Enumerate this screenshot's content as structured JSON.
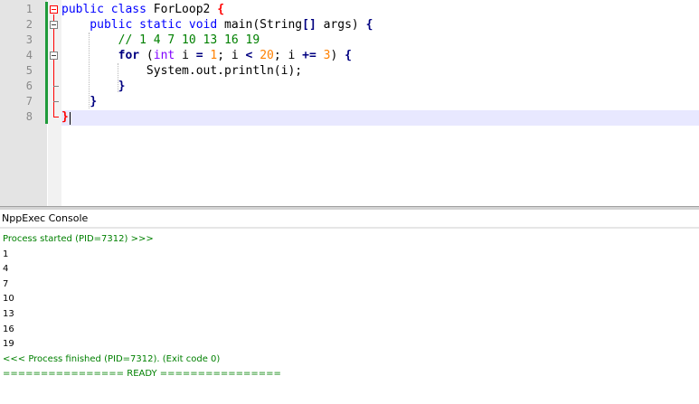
{
  "editor": {
    "line_numbers": [
      "1",
      "2",
      "3",
      "4",
      "5",
      "6",
      "7",
      "8"
    ],
    "lines": [
      [
        {
          "t": "public class ",
          "c": "kw"
        },
        {
          "t": "ForLoop2 ",
          "c": "plain"
        },
        {
          "t": "{",
          "c": "brace-red"
        }
      ],
      [
        {
          "t": "    public static void ",
          "c": "kw"
        },
        {
          "t": "main(",
          "c": "plain"
        },
        {
          "t": "String",
          "c": "plain"
        },
        {
          "t": "[]",
          "c": "op"
        },
        {
          "t": " args) ",
          "c": "plain"
        },
        {
          "t": "{",
          "c": "op"
        }
      ],
      [
        {
          "t": "        // 1 4 7 10 13 16 19",
          "c": "comment"
        }
      ],
      [
        {
          "t": "        ",
          "c": "plain"
        },
        {
          "t": "for",
          "c": "op"
        },
        {
          "t": " (",
          "c": "plain"
        },
        {
          "t": "int",
          "c": "type"
        },
        {
          "t": " i ",
          "c": "plain"
        },
        {
          "t": "=",
          "c": "op"
        },
        {
          "t": " ",
          "c": "plain"
        },
        {
          "t": "1",
          "c": "num"
        },
        {
          "t": "; i ",
          "c": "plain"
        },
        {
          "t": "<",
          "c": "op"
        },
        {
          "t": " ",
          "c": "plain"
        },
        {
          "t": "20",
          "c": "num"
        },
        {
          "t": "; i ",
          "c": "plain"
        },
        {
          "t": "+=",
          "c": "op"
        },
        {
          "t": " ",
          "c": "plain"
        },
        {
          "t": "3",
          "c": "num"
        },
        {
          "t": ") ",
          "c": "plain"
        },
        {
          "t": "{",
          "c": "op"
        }
      ],
      [
        {
          "t": "            System.out.println(i);",
          "c": "plain"
        }
      ],
      [
        {
          "t": "        ",
          "c": "plain"
        },
        {
          "t": "}",
          "c": "op"
        }
      ],
      [
        {
          "t": "    ",
          "c": "plain"
        },
        {
          "t": "}",
          "c": "op"
        }
      ],
      [
        {
          "t": "}",
          "c": "brace-red"
        }
      ]
    ]
  },
  "console": {
    "title": "NppExec Console",
    "lines": [
      {
        "text": "Process started (PID=7312) >>>",
        "green": true
      },
      {
        "text": "1",
        "green": false
      },
      {
        "text": "4",
        "green": false
      },
      {
        "text": "7",
        "green": false
      },
      {
        "text": "10",
        "green": false
      },
      {
        "text": "13",
        "green": false
      },
      {
        "text": "16",
        "green": false
      },
      {
        "text": "19",
        "green": false
      },
      {
        "text": "<<< Process finished (PID=7312). (Exit code 0)",
        "green": true
      },
      {
        "text": "================ READY ================",
        "green": true
      }
    ]
  }
}
